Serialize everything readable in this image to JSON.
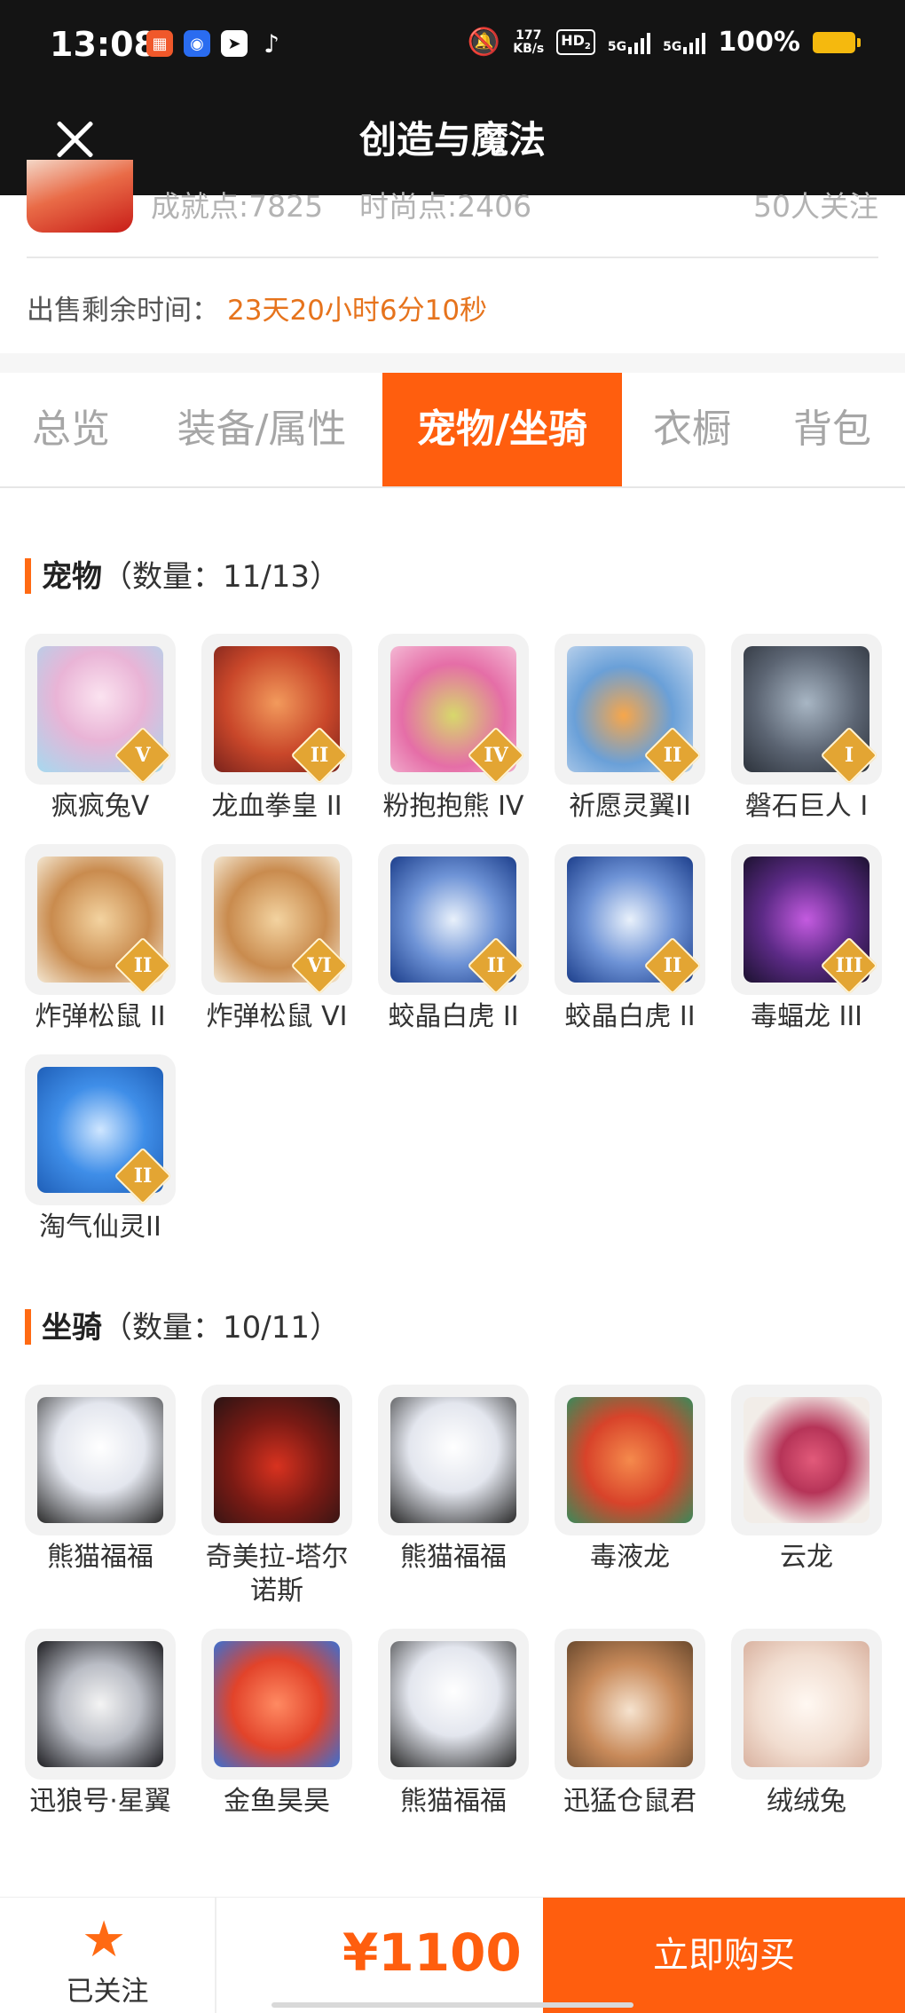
{
  "status": {
    "time": "13:08",
    "net_speed_top": "177",
    "net_speed_bottom": "KB/s",
    "hd": "HD",
    "hd_sub": "2",
    "sig1": "5G",
    "sig2": "5G",
    "battery": "100%",
    "apps": [
      "app-grid-icon",
      "browser-icon",
      "paper-plane-icon",
      "tiktok-icon"
    ]
  },
  "header": {
    "title": "创造与魔法",
    "close_icon": "close-icon"
  },
  "seller": {
    "achievement": "成就点:7825",
    "fashion": "时尚点:2406",
    "followers": "50人关注",
    "sale_label": "出售剩余时间：",
    "sale_time": "23天20小时6分10秒"
  },
  "tabs": [
    {
      "label": "总览",
      "active": false
    },
    {
      "label": "装备/属性",
      "active": false
    },
    {
      "label": "宠物/坐骑",
      "active": true
    },
    {
      "label": "衣橱",
      "active": false
    },
    {
      "label": "背包",
      "active": false
    }
  ],
  "pets": {
    "title": "宠物",
    "count": "（数量：11/13）",
    "items": [
      {
        "name": "疯疯兔V",
        "badge": "V"
      },
      {
        "name": "龙血拳皇 II",
        "badge": "II"
      },
      {
        "name": "粉抱抱熊 IV",
        "badge": "IV"
      },
      {
        "name": "祈愿灵翼II",
        "badge": "II"
      },
      {
        "name": "磐石巨人 I",
        "badge": "I"
      },
      {
        "name": "炸弹松鼠 II",
        "badge": "II"
      },
      {
        "name": "炸弹松鼠 VI",
        "badge": "VI"
      },
      {
        "name": "蛟晶白虎 II",
        "badge": "II"
      },
      {
        "name": "蛟晶白虎 II",
        "badge": "II"
      },
      {
        "name": "毒蝠龙 III",
        "badge": "III"
      },
      {
        "name": "淘气仙灵II",
        "badge": "II"
      }
    ]
  },
  "mounts": {
    "title": "坐骑",
    "count": "（数量：10/11）",
    "items": [
      {
        "name": "熊猫福福"
      },
      {
        "name": "奇美拉-塔尔诺斯"
      },
      {
        "name": "熊猫福福"
      },
      {
        "name": "毒液龙"
      },
      {
        "name": "云龙"
      },
      {
        "name": "迅狼号·星翼"
      },
      {
        "name": "金鱼昊昊"
      },
      {
        "name": "熊猫福福"
      },
      {
        "name": "迅猛仓鼠君"
      },
      {
        "name": "绒绒兔"
      }
    ]
  },
  "footer": {
    "follow_label": "已关注",
    "follow_icon": "star-icon",
    "price": "¥1100",
    "buy_label": "立即购买"
  },
  "colors": {
    "accent": "#ff5e0e",
    "countdown": "#e6731c",
    "header_bg": "#141414"
  }
}
